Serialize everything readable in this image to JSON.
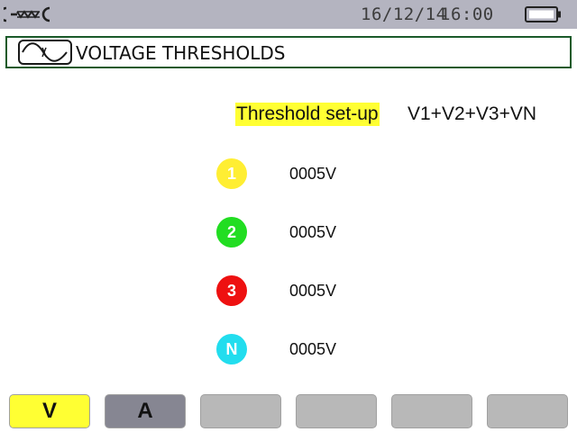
{
  "status_bar": {
    "date": "16/12/14",
    "time": "16:00",
    "icons": [
      "wrench-icon",
      "battery-icon"
    ]
  },
  "header": {
    "title": "VOLTAGE THRESHOLDS",
    "icon": "waveform-icon"
  },
  "setup": {
    "label": "Threshold set-up",
    "value": "V1+V2+V3+VN",
    "label_color": "#ffff33"
  },
  "channels": [
    {
      "badge": "1",
      "value": "0005V",
      "color": "#ffee33"
    },
    {
      "badge": "2",
      "value": "0005V",
      "color": "#22dd22"
    },
    {
      "badge": "3",
      "value": "0005V",
      "color": "#ee1111"
    },
    {
      "badge": "N",
      "value": "0005V",
      "color": "#22ddee"
    }
  ],
  "softkeys": [
    {
      "label": "V",
      "color": "#ffff33",
      "state": "selected"
    },
    {
      "label": "A",
      "color": "#868692",
      "state": "available"
    },
    {
      "label": "",
      "color": "#b8b8b8",
      "state": "empty"
    },
    {
      "label": "",
      "color": "#b8b8b8",
      "state": "empty"
    },
    {
      "label": "",
      "color": "#b8b8b8",
      "state": "empty"
    },
    {
      "label": "",
      "color": "#b8b8b8",
      "state": "empty"
    }
  ]
}
